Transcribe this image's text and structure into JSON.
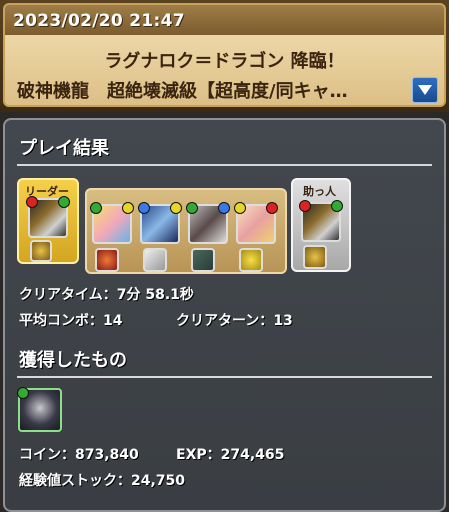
{
  "header": {
    "date": "2023/02/20 21:47",
    "title_line1": "ラグナロク＝ドラゴン 降臨！",
    "title_line2": "破神機龍　超絶壊滅級【超高度/同キャ…",
    "dropdown_icon": "chevron-down-icon"
  },
  "result": {
    "section_title": "プレイ結果",
    "leader_label": "リーダー",
    "helper_label": "助っ人",
    "clear_time_label": "クリアタイム：",
    "clear_time_value": "7分 58.1秒",
    "avg_combo_label": "平均コンボ：",
    "avg_combo_value": "14",
    "clear_turn_label": "クリアターン：",
    "clear_turn_value": "13"
  },
  "rewards": {
    "section_title": "獲得したもの",
    "coin_label": "コイン：",
    "coin_value": "873,840",
    "exp_label": "EXP：",
    "exp_value": "274,465",
    "stock_label": "経験値ストック：",
    "stock_value": "24,750"
  },
  "colors": {
    "leader_frame": "#e8c33a",
    "helper_frame": "#b9b9b9",
    "team_frame": "#c9a86a",
    "panel_bg": "#3f4348"
  }
}
